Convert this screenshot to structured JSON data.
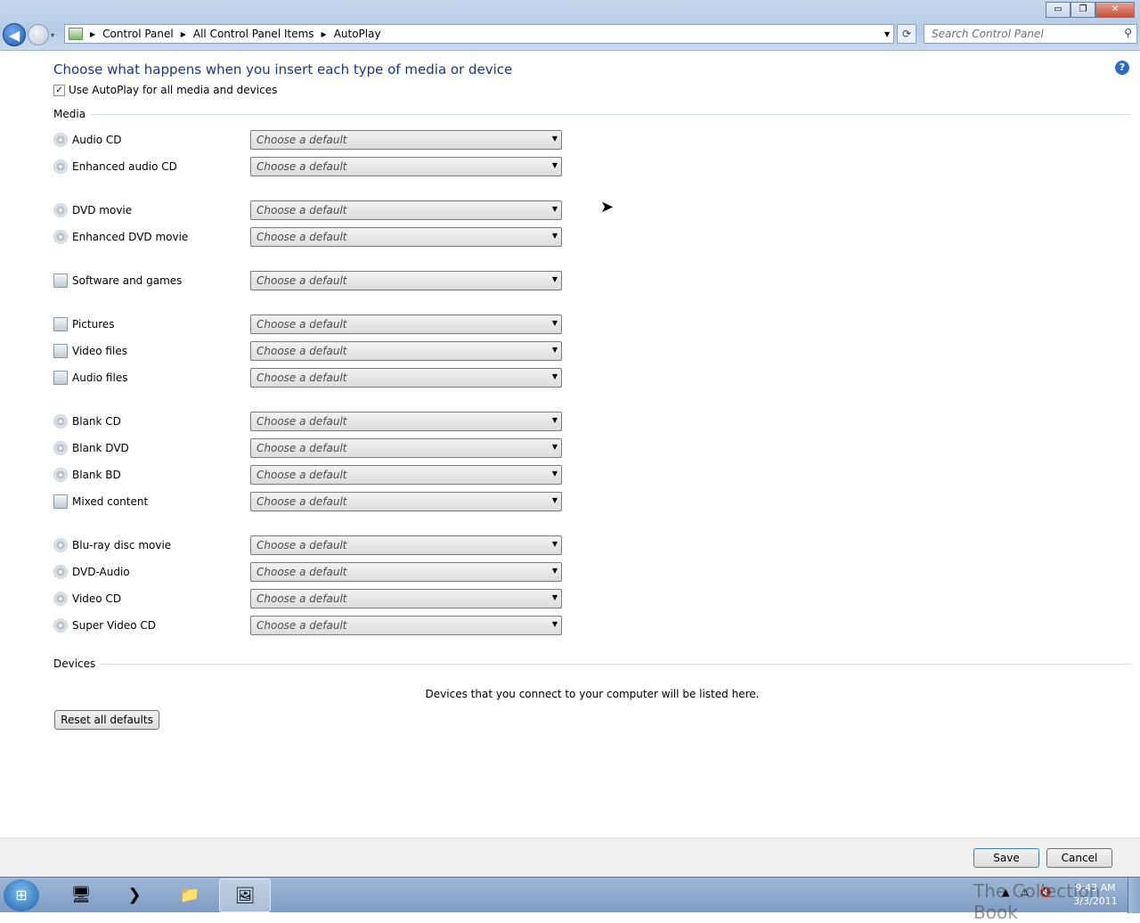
{
  "window": {
    "minimize": "▭",
    "maximize": "❐",
    "close": "✕"
  },
  "nav": {
    "back_icon": "◀",
    "dropdown": "▾"
  },
  "breadcrumb": [
    "Control Panel",
    "All Control Panel Items",
    "AutoPlay"
  ],
  "search": {
    "placeholder": "Search Control Panel",
    "icon": "⚲"
  },
  "refresh_icon": "⟳",
  "heading": "Choose what happens when you insert each type of media or device",
  "help": "?",
  "use_autoplay": {
    "label": "Use AutoPlay for all media and devices",
    "checked": true,
    "mark": "✓"
  },
  "media_section": "Media",
  "select_default": "Choose a default",
  "media_groups": [
    [
      {
        "label": "Audio CD",
        "icon": "disc"
      },
      {
        "label": "Enhanced audio CD",
        "icon": "disc"
      }
    ],
    [
      {
        "label": "DVD movie",
        "icon": "disc"
      },
      {
        "label": "Enhanced DVD movie",
        "icon": "disc"
      }
    ],
    [
      {
        "label": "Software and games",
        "icon": "file"
      }
    ],
    [
      {
        "label": "Pictures",
        "icon": "file"
      },
      {
        "label": "Video files",
        "icon": "file"
      },
      {
        "label": "Audio files",
        "icon": "file"
      }
    ],
    [
      {
        "label": "Blank CD",
        "icon": "disc"
      },
      {
        "label": "Blank DVD",
        "icon": "disc"
      },
      {
        "label": "Blank BD",
        "icon": "disc"
      },
      {
        "label": "Mixed content",
        "icon": "file"
      }
    ],
    [
      {
        "label": "Blu-ray disc movie",
        "icon": "disc"
      },
      {
        "label": "DVD-Audio",
        "icon": "disc"
      },
      {
        "label": "Video CD",
        "icon": "disc"
      },
      {
        "label": "Super Video CD",
        "icon": "disc"
      }
    ]
  ],
  "devices_section": "Devices",
  "devices_note": "Devices that you connect to your computer will be listed here.",
  "reset_button": "Reset all defaults",
  "save_button": "Save",
  "cancel_button": "Cancel",
  "taskbar": {
    "start": "⊞",
    "items": [
      "🖥",
      "❯",
      "📁",
      "🖼"
    ],
    "tray_up": "▲",
    "tray_net": "⚠",
    "tray_vol": "🔇",
    "time": "9:43 AM",
    "date": "3/3/2011",
    "watermark": "The Collection Book"
  }
}
